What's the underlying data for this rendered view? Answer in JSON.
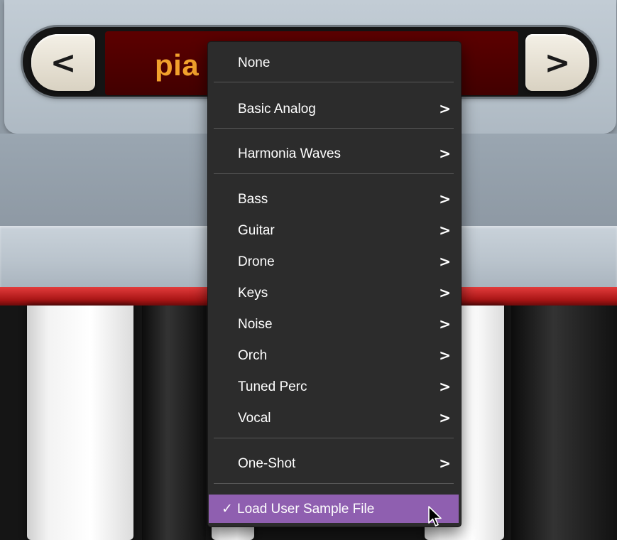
{
  "preset": {
    "name_visible": "pia",
    "prev_label": "<",
    "next_label": ">"
  },
  "menu": {
    "items": [
      {
        "label": "None",
        "submenu": false
      },
      {
        "label": "Basic Analog",
        "submenu": true
      },
      {
        "label": "Harmonia Waves",
        "submenu": true
      },
      {
        "label": "Bass",
        "submenu": true
      },
      {
        "label": "Guitar",
        "submenu": true
      },
      {
        "label": "Drone",
        "submenu": true
      },
      {
        "label": "Keys",
        "submenu": true
      },
      {
        "label": "Noise",
        "submenu": true
      },
      {
        "label": "Orch",
        "submenu": true
      },
      {
        "label": "Tuned Perc",
        "submenu": true
      },
      {
        "label": "Vocal",
        "submenu": true
      },
      {
        "label": "One-Shot",
        "submenu": true
      },
      {
        "label": "Load User Sample File",
        "submenu": false,
        "checked": true
      }
    ],
    "submenu_arrow": ">",
    "check_mark": "✓",
    "highlight_color": "#8f5fb0"
  }
}
